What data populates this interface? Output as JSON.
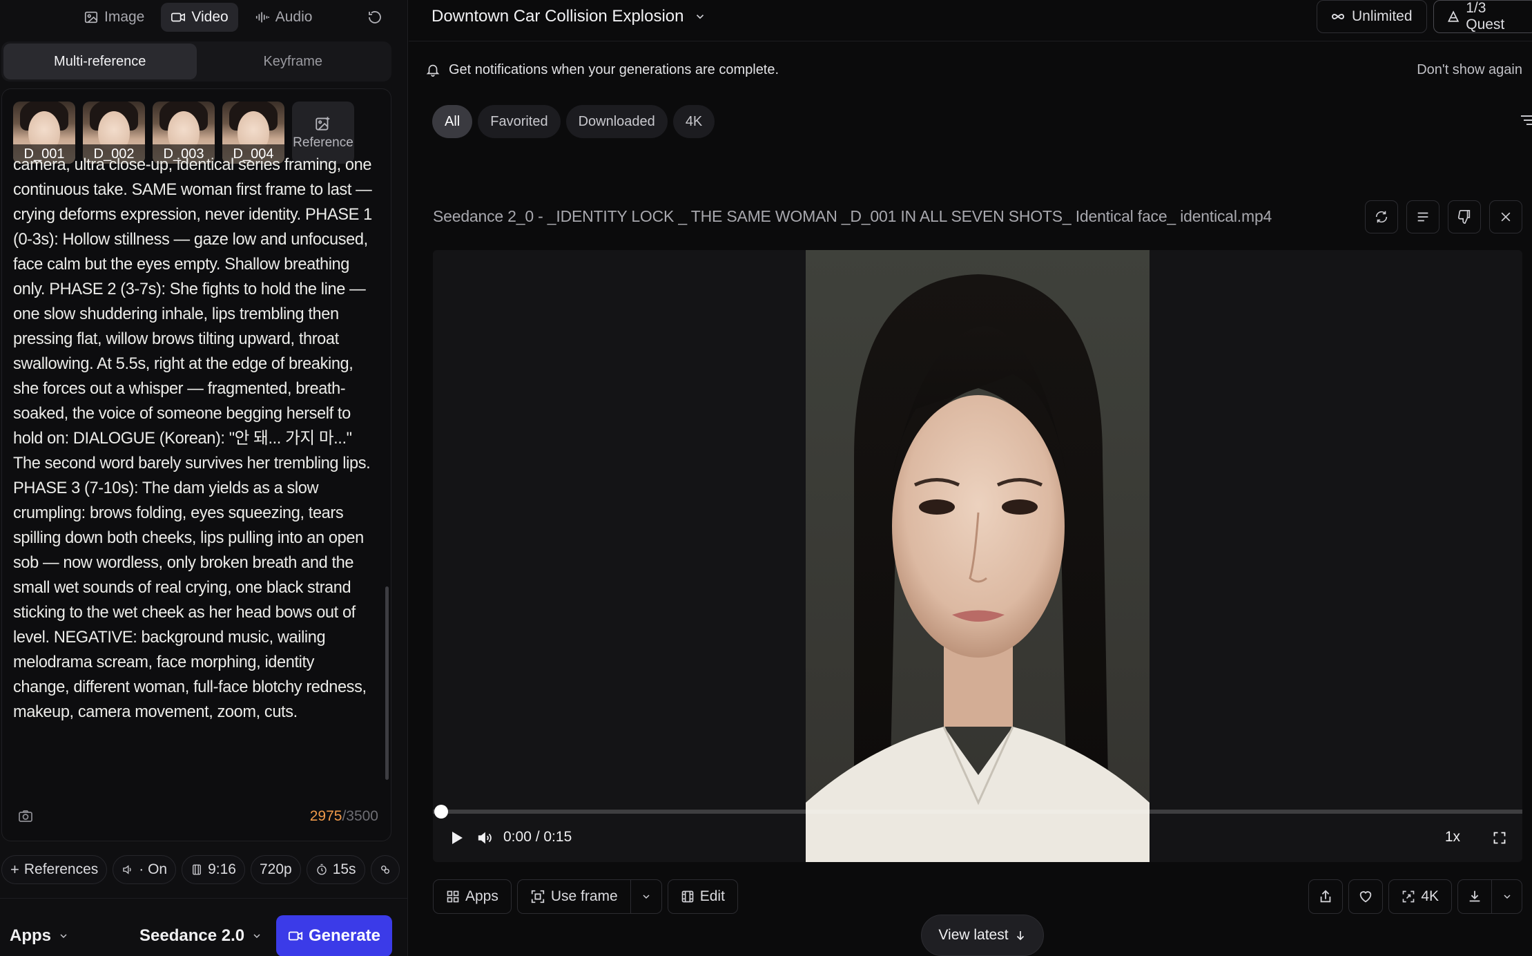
{
  "mode_tabs": [
    {
      "label": "Image",
      "icon": "image-icon"
    },
    {
      "label": "Video",
      "icon": "video-icon",
      "active": true
    },
    {
      "label": "Audio",
      "icon": "audio-icon"
    }
  ],
  "ref_tabs": [
    {
      "label": "Multi-reference",
      "active": true
    },
    {
      "label": "Keyframe"
    }
  ],
  "references": [
    {
      "label": "D_001"
    },
    {
      "label": "D_002"
    },
    {
      "label": "D_003"
    },
    {
      "label": "D_004"
    }
  ],
  "reference_add_label": "Reference",
  "prompt_text": "camera, ultra close-up, identical series framing, one continuous take. SAME woman first frame to last — crying deforms expression, never identity. PHASE 1 (0-3s): Hollow stillness — gaze low and unfocused, face calm but the eyes empty. Shallow breathing only. PHASE 2 (3-7s): She fights to hold the line — one slow shuddering inhale, lips trembling then pressing flat, willow brows tilting upward, throat swallowing. At 5.5s, right at the edge of breaking, she forces out a whisper — fragmented, breath-soaked, the voice of someone begging herself to hold on: DIALOGUE (Korean): \"안 돼... 가지 마...\" The second word barely survives her trembling lips. PHASE 3 (7-10s): The dam yields as a slow crumpling: brows folding, eyes squeezing, tears spilling down both cheeks, lips pulling into an open sob — now wordless, only broken breath and the small wet sounds of real crying, one black strand sticking to the wet cheek as her head bows out of level. NEGATIVE: background music, wailing melodrama scream, face morphing, identity change, different woman, full-face blotchy redness, makeup, camera movement, zoom, cuts.",
  "char_count": "2975",
  "char_max": "/3500",
  "options": {
    "references": "References",
    "audio": "· On",
    "ratio": "9:16",
    "resolution": "720p",
    "duration": "15s"
  },
  "bottom": {
    "apps": "Apps",
    "model": "Seedance 2.0",
    "generate": "Generate"
  },
  "topbar": {
    "project_title": "Downtown Car Collision Explosion",
    "unlimited": "Unlimited",
    "quests": "1/3 Quest"
  },
  "notice": {
    "text": "Get notifications when your generations are complete.",
    "dismiss": "Don't show again"
  },
  "filters": [
    "All",
    "Favorited",
    "Downloaded",
    "4K"
  ],
  "video": {
    "file_title": "Seedance 2_0 - _IDENTITY LOCK _ THE SAME WOMAN _D_001 IN ALL SEVEN SHOTS_ Identical face_ identical.mp4",
    "time": "0:00 / 0:15",
    "speed": "1x",
    "progress": 0
  },
  "video_actions": {
    "apps": "Apps",
    "use_frame": "Use frame",
    "edit": "Edit",
    "quality": "4K"
  },
  "view_latest": "View latest",
  "colors": {
    "accent": "#3b3be8",
    "counter": "#f09a4a",
    "background": "#0a0a0b"
  }
}
